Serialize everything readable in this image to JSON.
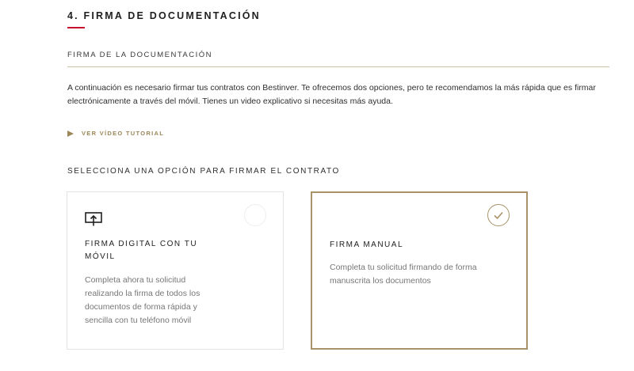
{
  "section": {
    "title": "4. FIRMA DE DOCUMENTACIÓN",
    "accent_color": "#c8102e"
  },
  "subsection": {
    "title": "FIRMA DE LA DOCUMENTACIÓN"
  },
  "intro_text": "A continuación es necesario firmar tus contratos con Bestinver. Te ofrecemos dos opciones, pero te recomendamos la más rápida que es firmar electrónicamente a través del móvil. Tienes un video explicativo si necesitas más ayuda.",
  "video_link": {
    "label": "VER VÍDEO TUTORIAL",
    "icon": "play-icon",
    "color": "#9b8758"
  },
  "choose_label": "SELECCIONA UNA OPCIÓN PARA FIRMAR EL CONTRATO",
  "options": [
    {
      "title": "FIRMA DIGITAL CON TU MÓVIL",
      "description": "Completa ahora tu solicitud realizando la firma de todos los documentos de forma rápida y sencilla con tu teléfono móvil",
      "icon": "upload-icon",
      "selected": false
    },
    {
      "title": "FIRMA MANUAL",
      "description": "Completa tu solicitud firmando de forma manuscrita los documentos",
      "icon": "check-icon",
      "selected": true
    }
  ],
  "selected_border_color": "#a89268"
}
